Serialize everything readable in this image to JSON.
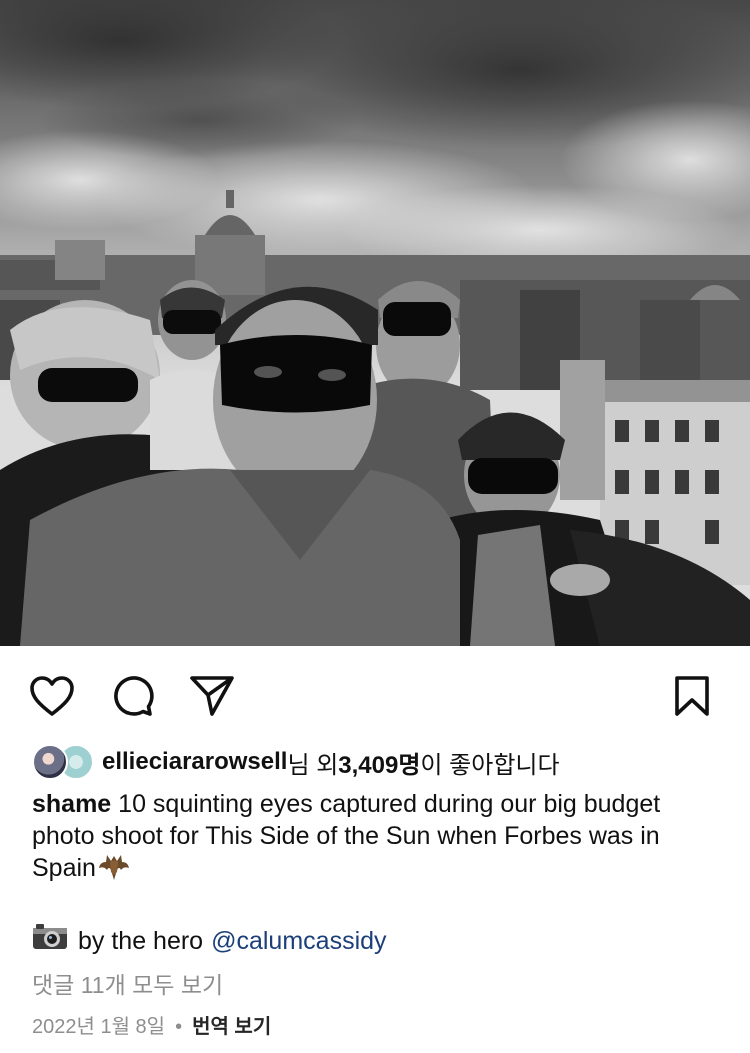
{
  "post": {
    "image_alt": "Black and white photo of five young men wearing black eye masks on a city rooftop"
  },
  "actions": {
    "like_icon": "heart-icon",
    "comment_icon": "comment-icon",
    "share_icon": "paper-plane-icon",
    "save_icon": "bookmark-icon"
  },
  "likes": {
    "username": "ellieciararowsell",
    "middle": "님 외 ",
    "count": "3,409명",
    "suffix": "이 좋아합니다"
  },
  "caption": {
    "author": "shame",
    "text": " 10 squinting eyes captured during our big budget photo shoot for This Side of the Sun when Forbes was in Spain",
    "emoji": "bat-emoji"
  },
  "credit": {
    "text": "by the hero",
    "mention": "@calumcassidy",
    "icon": "camera-emoji"
  },
  "comments": {
    "view_all": "댓글 11개 모두 보기"
  },
  "meta": {
    "date": "2022년 1월 8일",
    "separator": "•",
    "translate": "번역 보기"
  }
}
